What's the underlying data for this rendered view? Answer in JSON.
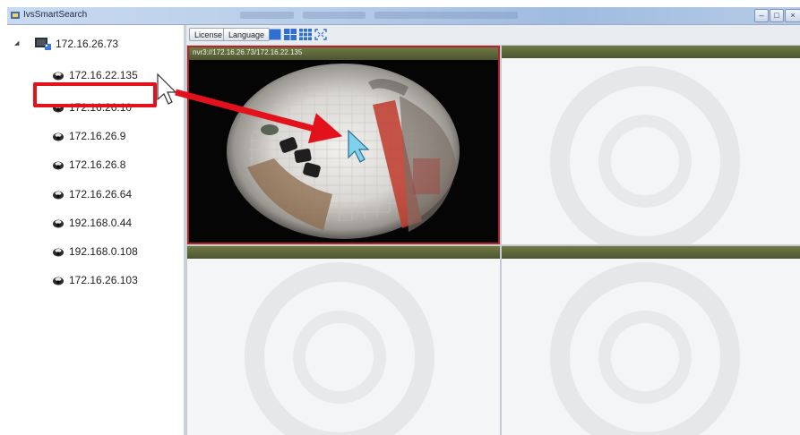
{
  "window": {
    "title": "IvsSmartSearch"
  },
  "toolbar": {
    "license_label": "License",
    "language_label": "Language",
    "layout_icons": [
      "single-view-icon",
      "quad-view-icon",
      "nine-view-icon",
      "fullscreen-icon"
    ]
  },
  "sidebar": {
    "root": {
      "label": "172.16.26.73",
      "icon": "nvr-icon"
    },
    "items": [
      {
        "label": "172.16.22.135",
        "icon": "camera-icon",
        "highlighted": true
      },
      {
        "label": "172.16.26.10",
        "icon": "camera-icon"
      },
      {
        "label": "172.16.26.9",
        "icon": "camera-icon"
      },
      {
        "label": "172.16.26.8",
        "icon": "camera-icon"
      },
      {
        "label": "172.16.26.64",
        "icon": "camera-icon"
      },
      {
        "label": "192.168.0.44",
        "icon": "camera-icon"
      },
      {
        "label": "192.168.0.108",
        "icon": "camera-icon"
      },
      {
        "label": "172.16.26.103",
        "icon": "camera-icon"
      }
    ]
  },
  "video_grid": {
    "cells": [
      {
        "caption": "nvr3://172.16.26.73/172.16.22.135",
        "active": true
      },
      {
        "caption": ""
      },
      {
        "caption": ""
      },
      {
        "caption": ""
      }
    ]
  },
  "colors": {
    "highlight_red": "#e3111b",
    "active_border": "#b0242a",
    "cell_header": "#5e6838",
    "cursor_target": "#7fd1ee"
  }
}
